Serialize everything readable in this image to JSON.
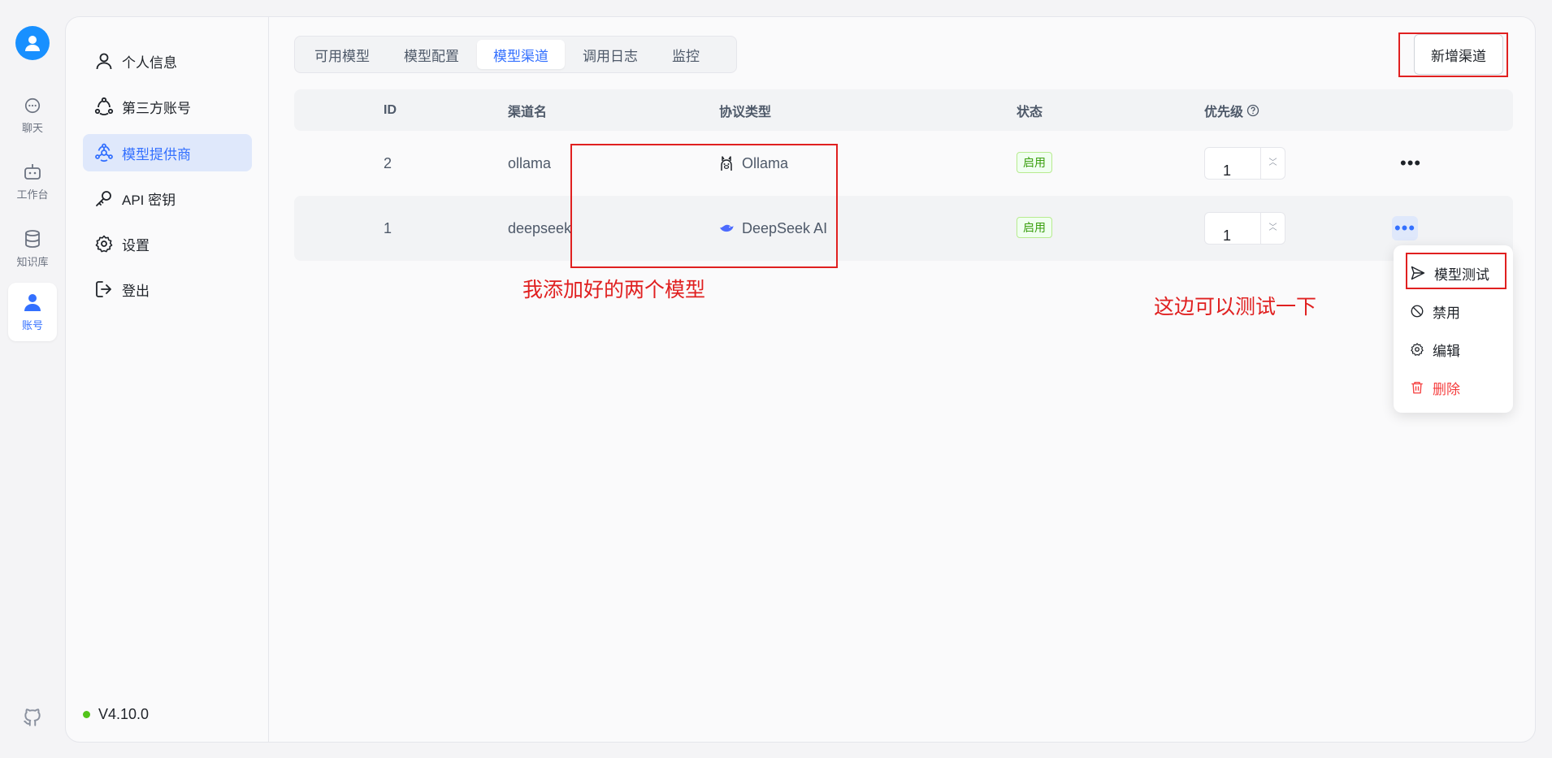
{
  "rail": {
    "items": [
      {
        "label": "聊天",
        "icon": "chat-icon"
      },
      {
        "label": "工作台",
        "icon": "robot-icon"
      },
      {
        "label": "知识库",
        "icon": "database-icon"
      },
      {
        "label": "账号",
        "icon": "user-icon",
        "active": true
      }
    ]
  },
  "sidebar": {
    "items": [
      {
        "label": "个人信息",
        "icon": "user-icon"
      },
      {
        "label": "第三方账号",
        "icon": "network-icon"
      },
      {
        "label": "模型提供商",
        "icon": "provider-icon",
        "active": true
      },
      {
        "label": "API 密钥",
        "icon": "key-icon"
      },
      {
        "label": "设置",
        "icon": "gear-icon"
      },
      {
        "label": "登出",
        "icon": "logout-icon"
      }
    ],
    "version": "V4.10.0"
  },
  "tabs": [
    {
      "label": "可用模型"
    },
    {
      "label": "模型配置"
    },
    {
      "label": "模型渠道",
      "active": true
    },
    {
      "label": "调用日志"
    },
    {
      "label": "监控"
    }
  ],
  "toolbar": {
    "add_label": "新增渠道"
  },
  "table": {
    "headers": {
      "id": "ID",
      "name": "渠道名",
      "protocol": "协议类型",
      "status": "状态",
      "priority": "优先级"
    },
    "rows": [
      {
        "id": "2",
        "name": "ollama",
        "protocol": "Ollama",
        "protocol_icon": "llama-icon",
        "status": "启用",
        "priority": "1"
      },
      {
        "id": "1",
        "name": "deepseek",
        "protocol": "DeepSeek AI",
        "protocol_icon": "whale-icon",
        "status": "启用",
        "priority": "1"
      }
    ]
  },
  "menu": {
    "items": [
      {
        "label": "模型测试",
        "icon": "send-icon"
      },
      {
        "label": "禁用",
        "icon": "ban-icon"
      },
      {
        "label": "编辑",
        "icon": "gear-icon"
      },
      {
        "label": "删除",
        "icon": "trash-icon",
        "danger": true
      }
    ]
  },
  "annotations": {
    "models_note": "我添加好的两个模型",
    "test_note": "这边可以测试一下"
  },
  "colors": {
    "accent": "#3370ff",
    "annotation": "#e02020",
    "status_ok": "#389e0d"
  }
}
